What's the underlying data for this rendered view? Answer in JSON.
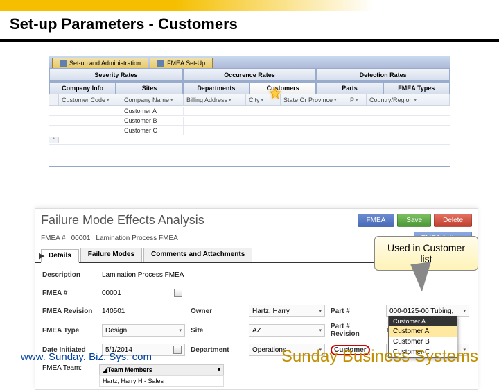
{
  "slide": {
    "title": "Set-up Parameters - Customers"
  },
  "footer": {
    "url": "www. Sunday. Biz. Sys. com",
    "brand": "Sunday Business Systems"
  },
  "appTabs": [
    {
      "label": "Set-up and Administration"
    },
    {
      "label": "FMEA Set-Up"
    }
  ],
  "rateTabs": [
    "Severity Rates",
    "Occurence Rates",
    "Detection Rates"
  ],
  "setupTabs": [
    "Company Info",
    "Sites",
    "Departments",
    "Customers",
    "Parts",
    "FMEA Types"
  ],
  "gridCols": [
    "Customer Code",
    "Company Name",
    "Billing Address",
    "City",
    "State Or Province",
    "P",
    "Country/Region"
  ],
  "gridRows": [
    {
      "company": "Customer A"
    },
    {
      "company": "Customer B"
    },
    {
      "company": "Customer C"
    }
  ],
  "fmea": {
    "title": "Failure Mode Effects Analysis",
    "idLabel": "FMEA #",
    "id": "00001",
    "name": "Lamination Process FMEA",
    "buttons": {
      "new": "FMEA",
      "save": "Save",
      "delete": "Delete",
      "actions": "FMEA Actions"
    },
    "tabs": [
      "Details",
      "Failure Modes",
      "Comments and Attachments"
    ],
    "fields": {
      "descLabel": "Description",
      "desc": "Lamination Process FMEA",
      "fmeanoLabel": "FMEA #",
      "fmeano": "00001",
      "revLabel": "FMEA Revision",
      "rev": "140501",
      "ownerLabel": "Owner",
      "owner": "Hartz, Harry",
      "partLabel": "Part #",
      "part": "000-0125-00  Tubing,",
      "typeLabel": "FMEA Type",
      "type": "Design",
      "siteLabel": "Site",
      "site": "AZ",
      "partrevLabel": "Part # Revision",
      "partrev": "1",
      "dateLabel": "Date Initiated",
      "date": "5/1/2014",
      "deptLabel": "Department",
      "dept": "Operations",
      "custLabel": "Customer"
    },
    "teamLabel": "FMEA Team:",
    "teamHeader": "Team Members",
    "teamRows": [
      "Hartz, Harry H - Sales"
    ]
  },
  "custDropdown": {
    "header": "Customer A",
    "items": [
      "Customer A",
      "Customer B",
      "Customer C"
    ]
  },
  "callout": {
    "text1": "Used in Customer",
    "text2": "list"
  }
}
